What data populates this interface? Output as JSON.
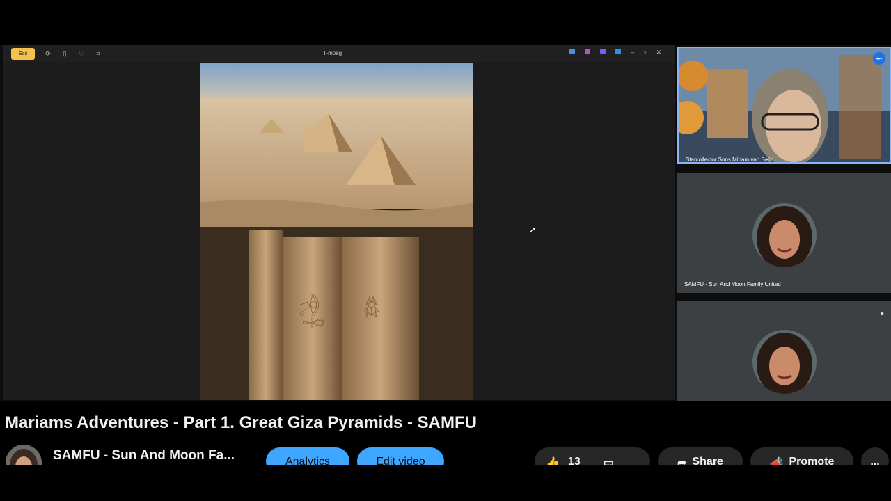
{
  "viewer": {
    "edit_label": "Edit",
    "window_title": "T-mpeg",
    "toolbar_icons": [
      "rotate-icon",
      "delete-icon",
      "heart-icon",
      "crop-icon",
      "more-icon"
    ]
  },
  "participants": [
    {
      "name": "Starcollector Sons Miriam van Beijn",
      "badge": "•••"
    },
    {
      "name": "SAMFU - Sun And Moon Family United"
    },
    {
      "name": ""
    }
  ],
  "video": {
    "title": "Mariams Adventures - Part 1. Great Giza Pyramids - SAMFU",
    "channel_name": "SAMFU - Sun And Moon Fa...",
    "analytics_label": "Analytics",
    "edit_video_label": "Edit video",
    "like_count": "13",
    "share_label": "Share",
    "promote_label": "Promote",
    "more_label": "..."
  },
  "colors": {
    "accent_blue": "#3ea6ff",
    "edit_yellow": "#f2c14e",
    "tile_gray": "#3c4043"
  }
}
